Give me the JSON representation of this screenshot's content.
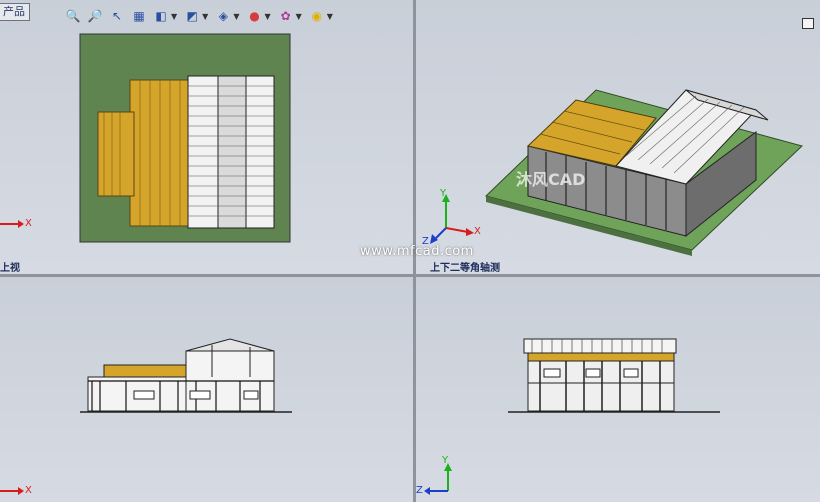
{
  "window": {
    "tab_label": "产品"
  },
  "toolbar": {
    "items": [
      {
        "icon": "zoom-to-fit-icon",
        "glyph": "🔍"
      },
      {
        "icon": "zoom-area-icon",
        "glyph": "🔎"
      },
      {
        "icon": "previous-view-icon",
        "glyph": "↖"
      },
      {
        "icon": "section-view-icon",
        "glyph": "▦"
      },
      {
        "icon": "view-orientation-icon",
        "glyph": "◧"
      },
      {
        "icon": "display-style-icon",
        "glyph": "◩"
      },
      {
        "icon": "hide-show-items-icon",
        "glyph": "◈"
      },
      {
        "icon": "edit-appearance-icon",
        "glyph": "●"
      },
      {
        "icon": "apply-scene-icon",
        "glyph": "✿"
      },
      {
        "icon": "view-settings-icon",
        "glyph": "◉"
      }
    ]
  },
  "viewports": {
    "top_left": {
      "label": "上视"
    },
    "top_right": {
      "label": "上下二等角轴测"
    },
    "bottom_left": {
      "label": ""
    },
    "bottom_right": {
      "label": ""
    }
  },
  "axes": {
    "x": "X",
    "y": "Y",
    "z": "Z"
  },
  "watermark": {
    "url": "www.mfcad.com",
    "logo": "沐风CAD"
  },
  "colors": {
    "ground": "#5f8450",
    "deck": "#d4a52a",
    "roof": "#f0f0f0",
    "background": "#cdd3dc",
    "axis_x": "#d81c1c",
    "axis_y": "#1bb11b",
    "axis_z": "#1f3fc8"
  }
}
